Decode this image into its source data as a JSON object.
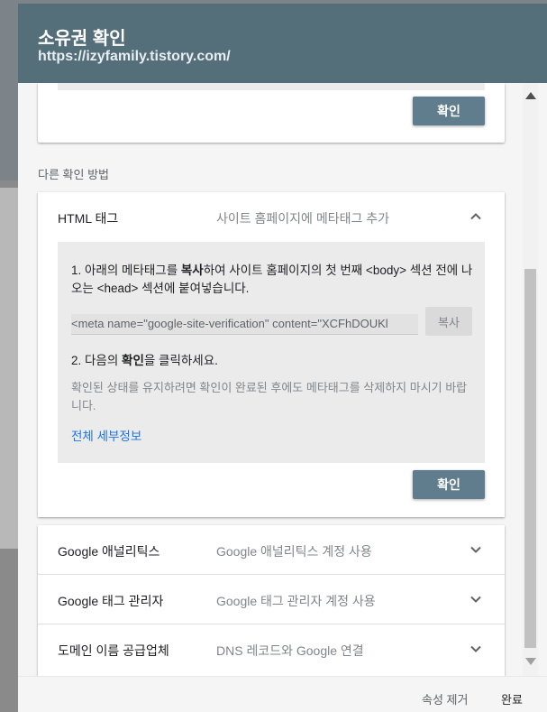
{
  "dialog": {
    "title": "소유권 확인",
    "subtitle": "https://izyfamily.tistory.com/"
  },
  "top_card": {
    "confirm_label": "확인"
  },
  "other_methods_label": "다른 확인 방법",
  "html_tag": {
    "name": "HTML 태그",
    "description": "사이트 홈페이지에 메타태그 추가",
    "expanded": true,
    "step1_prefix": "1. 아래의 메타태그를 ",
    "step1_bold": "복사",
    "step1_suffix": "하여 사이트 홈페이지의 첫 번째 <body> 섹션 전에 나오는 <head> 섹션에 붙여넣습니다.",
    "meta_value": "<meta name=\"google-site-verification\" content=\"XCFhDOUKl",
    "copy_label": "복사",
    "step2_prefix": "2. 다음의 ",
    "step2_bold": "확인",
    "step2_suffix": "을 클릭하세요.",
    "note": "확인된 상태를 유지하려면 확인이 완료된 후에도 메타태그를 삭제하지 마시기 바랍니다.",
    "details_link": "전체 세부정보",
    "confirm_label": "확인"
  },
  "methods": [
    {
      "name": "Google 애널리틱스",
      "description": "Google 애널리틱스 계정 사용"
    },
    {
      "name": "Google 태그 관리자",
      "description": "Google 태그 관리자 계정 사용"
    },
    {
      "name": "도메인 이름 공급업체",
      "description": "DNS 레코드와 Google 연결"
    }
  ],
  "footer": {
    "remove_label": "속성 제거",
    "done_label": "완료"
  },
  "colors": {
    "header": "#546e7a",
    "confirm_button": "#5f7d8c",
    "link": "#1a73e8"
  }
}
